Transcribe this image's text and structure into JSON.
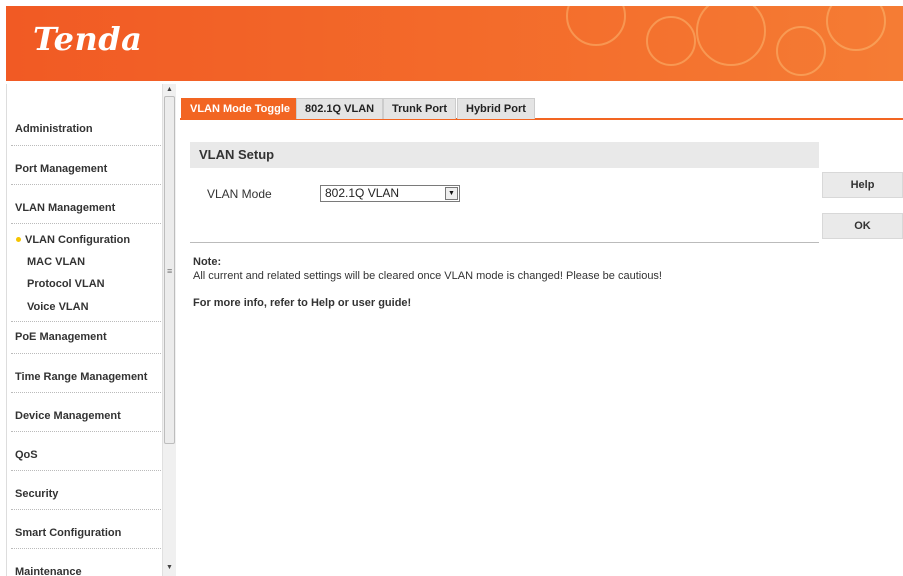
{
  "header": {
    "logo_text": "Tenda"
  },
  "sidebar": {
    "items": [
      {
        "label": "Administration"
      },
      {
        "label": "Port Management"
      },
      {
        "label": "VLAN Management"
      },
      {
        "label": "PoE Management"
      },
      {
        "label": "Time Range Management"
      },
      {
        "label": "Device Management"
      },
      {
        "label": "QoS"
      },
      {
        "label": "Security"
      },
      {
        "label": "Smart Configuration"
      },
      {
        "label": "Maintenance"
      }
    ],
    "vlan_sub_items": [
      {
        "label": "VLAN Configuration",
        "active": true
      },
      {
        "label": "MAC VLAN"
      },
      {
        "label": "Protocol VLAN"
      },
      {
        "label": "Voice VLAN"
      }
    ]
  },
  "tabs": [
    {
      "label": "VLAN Mode Toggle",
      "active": true
    },
    {
      "label": "802.1Q VLAN"
    },
    {
      "label": "Trunk Port"
    },
    {
      "label": "Hybrid Port"
    }
  ],
  "panel": {
    "title": "VLAN Setup",
    "vlan_mode_label": "VLAN Mode",
    "vlan_mode_value": "802.1Q VLAN",
    "note_title": "Note:",
    "note_text": "All current and related settings will be cleared once VLAN mode is changed! Please be cautious!",
    "more_info": "For more info, refer to Help or user guide!"
  },
  "buttons": {
    "help": "Help",
    "ok": "OK"
  },
  "colors": {
    "accent": "#f26522",
    "active_dot": "#f5c400"
  }
}
